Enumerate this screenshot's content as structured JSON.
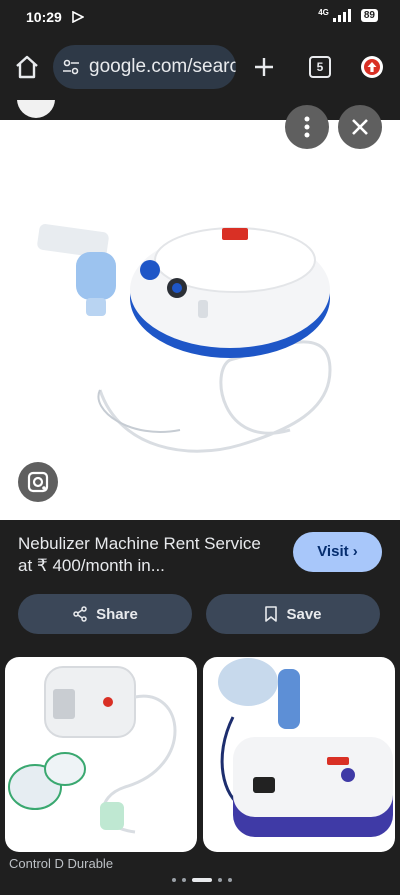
{
  "status_bar": {
    "time": "10:29",
    "network": "4G",
    "battery": "89"
  },
  "browser": {
    "url": "google.com/search",
    "tab_count": "5",
    "icons": [
      "home-icon",
      "tune-icon",
      "plus-icon",
      "tabs-icon",
      "update-icon"
    ]
  },
  "viewer": {
    "controls": [
      "more-vert-icon",
      "close-icon",
      "lens-icon"
    ]
  },
  "result": {
    "title": "Nebulizer Machine Rent Service at ₹ 400/month in...",
    "visit_label": "Visit",
    "share_label": "Share",
    "save_label": "Save"
  },
  "related": {
    "caption": "Control D Durable"
  },
  "colors": {
    "background": "#1f1f1f",
    "omnibox": "#2e3947",
    "visit_button": "#a8c7fa",
    "action_button": "#3b4758"
  }
}
